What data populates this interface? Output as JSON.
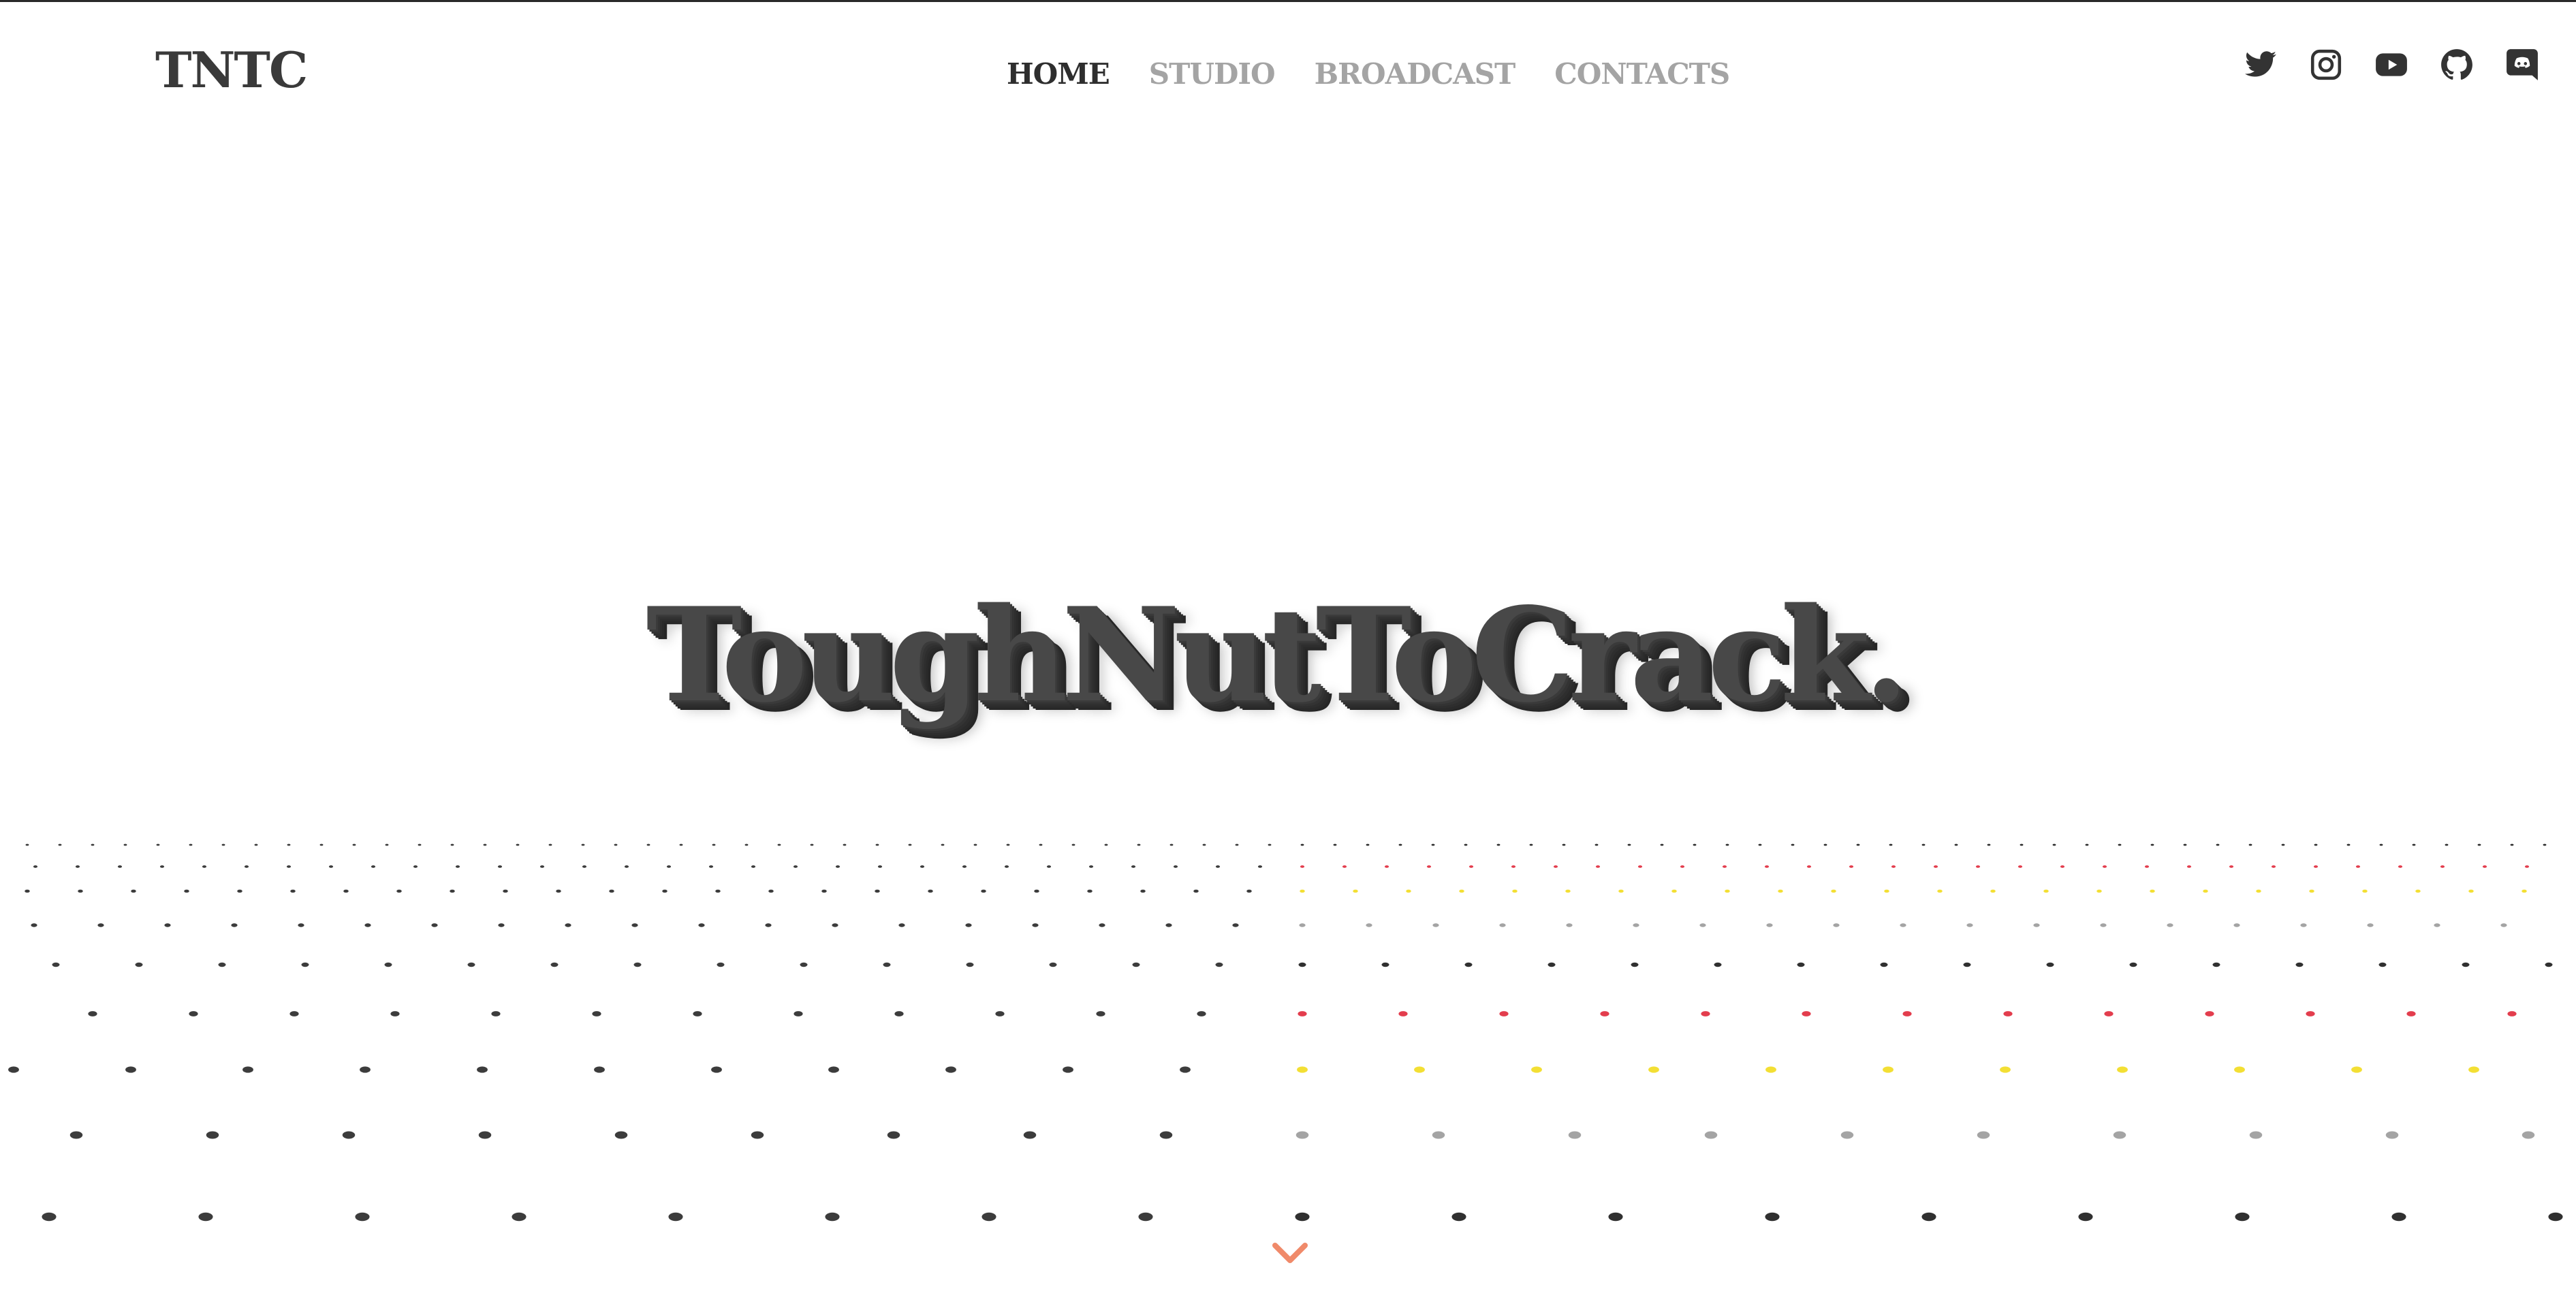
{
  "brand": "TNTC",
  "nav": {
    "items": [
      {
        "label": "HOME",
        "active": true
      },
      {
        "label": "STUDIO",
        "active": false
      },
      {
        "label": "BROADCAST",
        "active": false
      },
      {
        "label": "CONTACTS",
        "active": false
      }
    ]
  },
  "social": [
    {
      "icon": "twitter-icon"
    },
    {
      "icon": "instagram-icon"
    },
    {
      "icon": "youtube-icon"
    },
    {
      "icon": "github-icon"
    },
    {
      "icon": "discord-icon"
    }
  ],
  "hero": {
    "title": "ToughNutToCrack."
  },
  "colors": {
    "text_dark": "#2e2e2e",
    "text_muted": "#a4a4a4",
    "hero": "#484848",
    "dot_black": "#1a1a1a",
    "dot_red": "#e0283a",
    "dot_yellow": "#f2dc1e",
    "dot_gray": "#9a9a9a",
    "scroll_arrow": "#f08a6a"
  },
  "scroll_icon": "chevron-down-icon"
}
